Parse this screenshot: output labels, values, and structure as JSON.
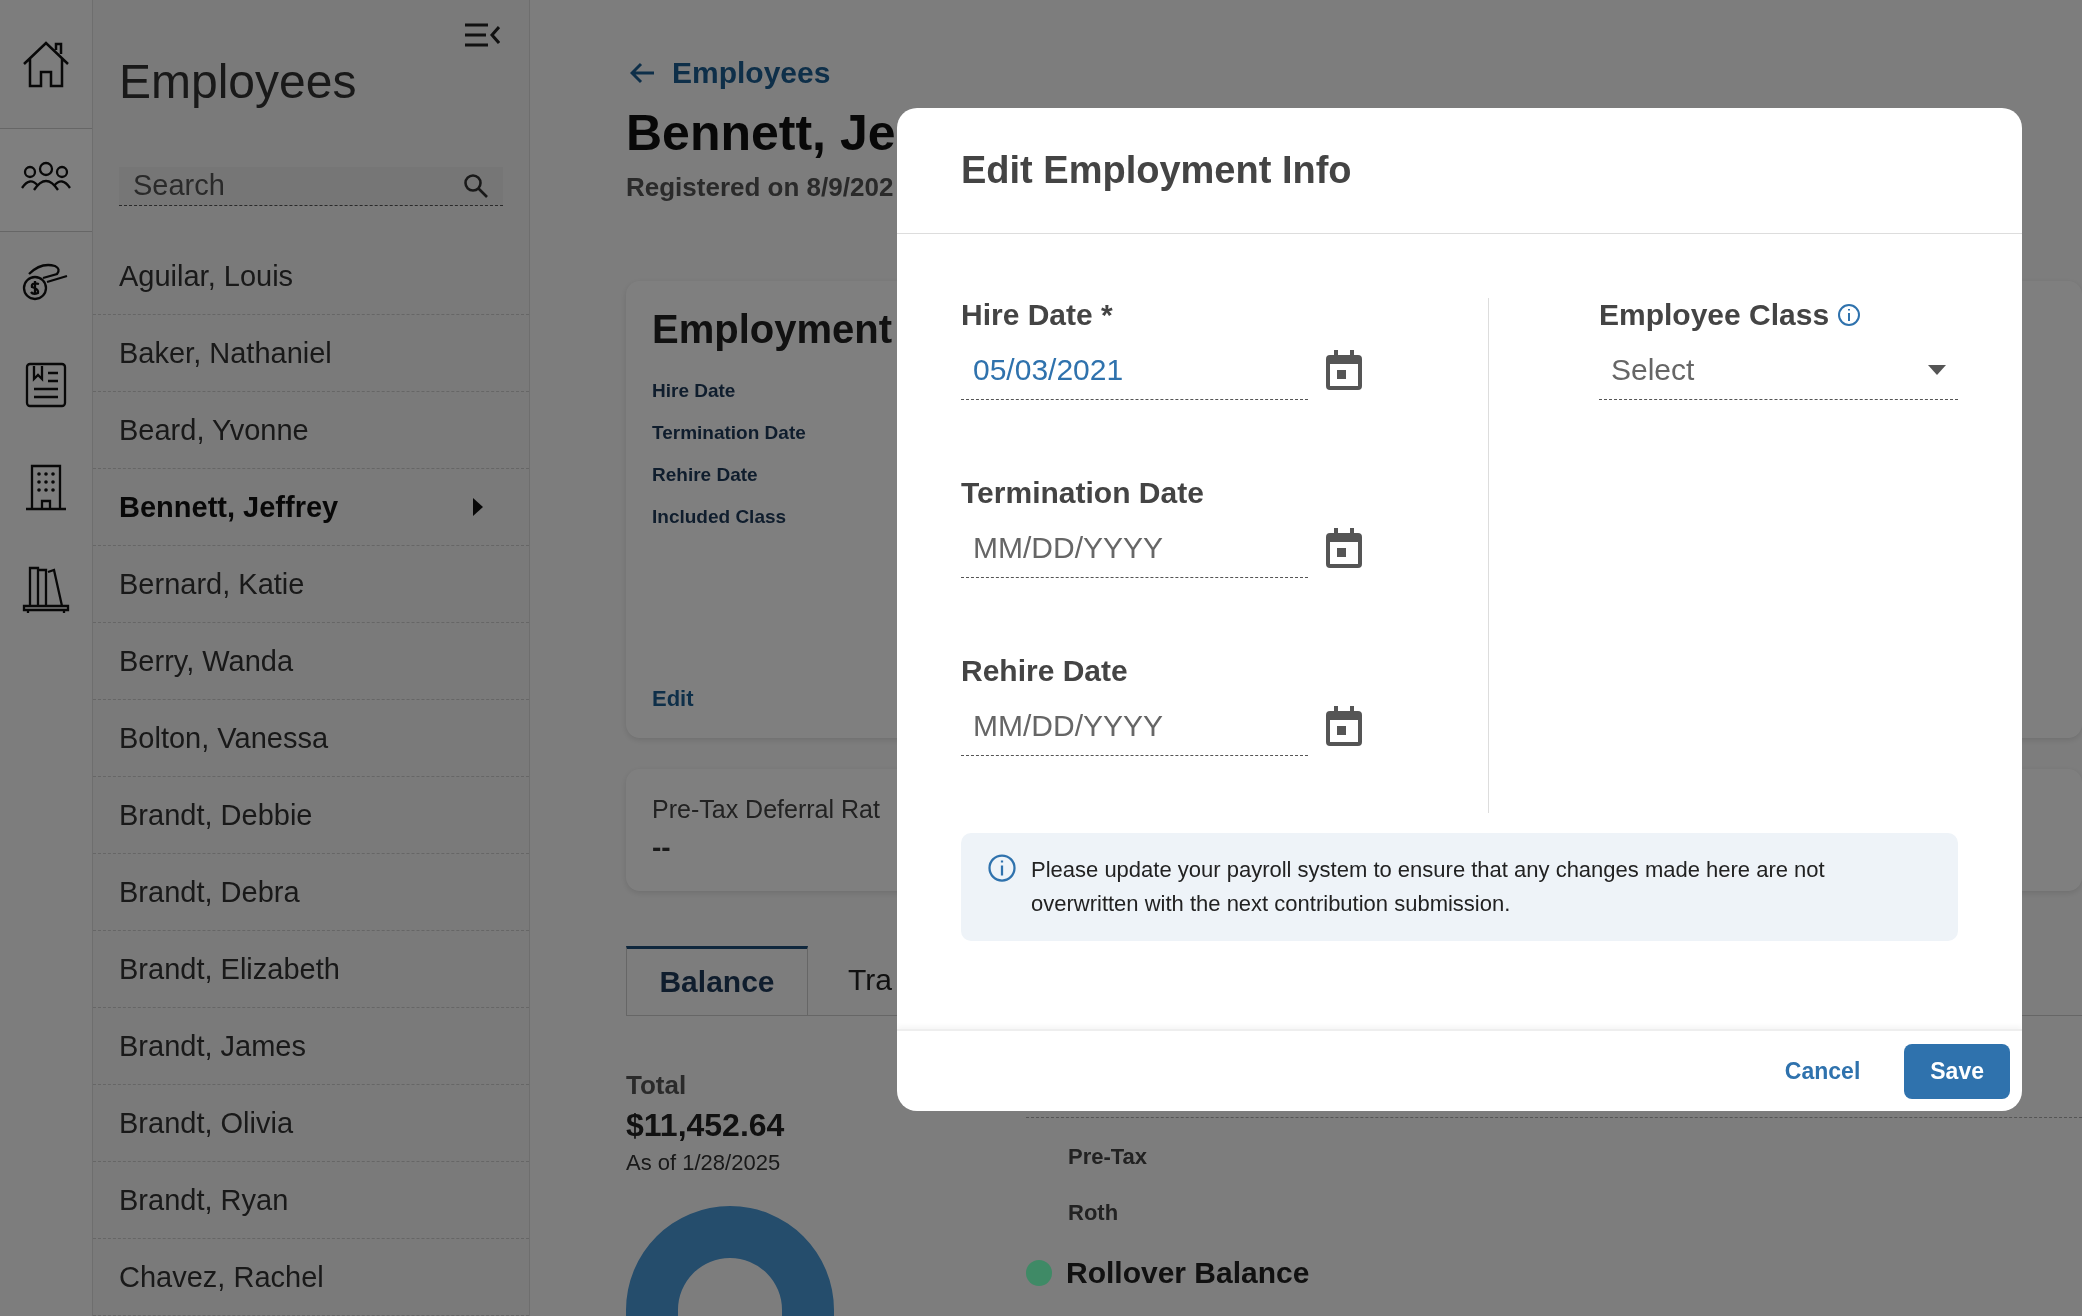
{
  "rail": [
    {
      "kind": "home",
      "selected": false
    },
    {
      "kind": "people",
      "selected": true
    },
    {
      "kind": "hand-coin",
      "selected": false
    },
    {
      "kind": "document",
      "selected": false
    },
    {
      "kind": "building",
      "selected": false
    },
    {
      "kind": "books",
      "selected": false
    }
  ],
  "sidebar": {
    "title": "Employees",
    "search": {
      "placeholder": "Search"
    },
    "employees": [
      {
        "name": "Aguilar, Louis",
        "selected": false
      },
      {
        "name": "Baker, Nathaniel",
        "selected": false
      },
      {
        "name": "Beard, Yvonne",
        "selected": false
      },
      {
        "name": "Bennett, Jeffrey",
        "selected": true
      },
      {
        "name": "Bernard, Katie",
        "selected": false
      },
      {
        "name": "Berry, Wanda",
        "selected": false
      },
      {
        "name": "Bolton, Vanessa",
        "selected": false
      },
      {
        "name": "Brandt, Debbie",
        "selected": false
      },
      {
        "name": "Brandt, Debra",
        "selected": false
      },
      {
        "name": "Brandt, Elizabeth",
        "selected": false
      },
      {
        "name": "Brandt, James",
        "selected": false
      },
      {
        "name": "Brandt, Olivia",
        "selected": false
      },
      {
        "name": "Brandt, Ryan",
        "selected": false
      },
      {
        "name": "Chavez, Rachel",
        "selected": false
      }
    ]
  },
  "main": {
    "breadcrumb": "Employees",
    "heading": "Bennett, Je",
    "registered": "Registered on 8/9/202",
    "employment_card": {
      "title": "Employment",
      "labels": [
        "Hire Date",
        "Termination Date",
        "Rehire Date",
        "Included Class"
      ],
      "edit": "Edit"
    },
    "deferral_card": {
      "label": "Pre-Tax Deferral Rat",
      "value": "--"
    },
    "tabs": [
      {
        "label": "Balance",
        "selected": true
      },
      {
        "label": "Tra",
        "selected": false
      }
    ],
    "total": {
      "label": "Total",
      "amount": "$11,452.64",
      "as_of": "As of 1/28/2025"
    },
    "balances": [
      {
        "kind": "sub",
        "label": "Pre-Tax"
      },
      {
        "kind": "sub",
        "label": "Roth"
      },
      {
        "kind": "group",
        "label": "Rollover Balance",
        "color": "#3f8a66"
      }
    ]
  },
  "modal": {
    "title": "Edit Employment Info",
    "left_fields": [
      {
        "label": "Hire Date *",
        "kind": "date",
        "value": "05/03/2021",
        "info": false
      },
      {
        "label": "Termination Date",
        "kind": "date",
        "placeholder": "MM/DD/YYYY",
        "info": false
      },
      {
        "label": "Rehire Date",
        "kind": "date",
        "placeholder": "MM/DD/YYYY",
        "info": false
      }
    ],
    "right_fields": [
      {
        "label": "Employee Class",
        "kind": "select",
        "placeholder": "Select",
        "info": true
      }
    ],
    "notice": "Please update your payroll system to ensure that any changes made here are not overwritten with the next contribution submission.",
    "buttons": [
      {
        "label": "Cancel",
        "kind": "text"
      },
      {
        "label": "Save",
        "kind": "primary"
      }
    ]
  }
}
